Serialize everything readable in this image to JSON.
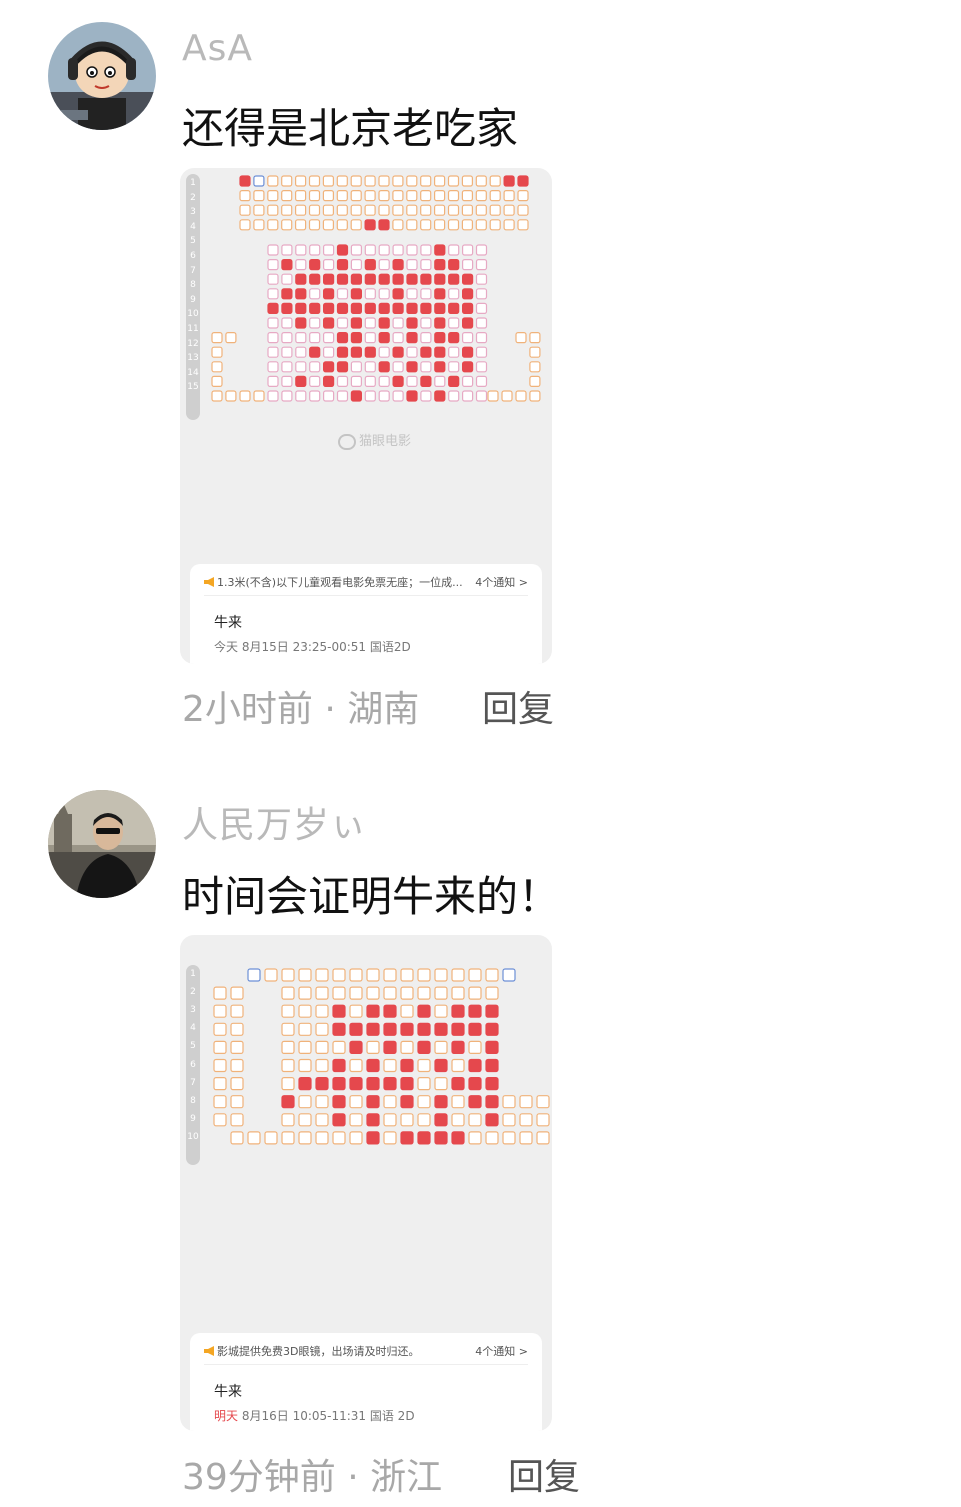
{
  "comments": [
    {
      "username": "AsA",
      "text": "还得是北京老吃家",
      "time_location": "2小时前 · 湖南",
      "reply_label": "回复",
      "avatar_icon": "cartoon-headphones-avatar",
      "screenshot": {
        "row_numbers": [
          "1",
          "2",
          "3",
          "4",
          "5",
          "6",
          "7",
          "8",
          "9",
          "10",
          "11",
          "12",
          "13",
          "14",
          "15"
        ],
        "watermark": "猫眼电影",
        "notice": "1.3米(不含)以下儿童观看电影免票无座；一位成...",
        "notice_count": "4个通知 >",
        "movie_title": "牛来",
        "showtime_day": "今天",
        "showtime": "8月15日 23:25-00:51 国语2D"
      }
    },
    {
      "username": "人民万岁ぃ",
      "text": "时间会证明牛来的！",
      "time_location": "39分钟前 · 浙江",
      "reply_label": "回复",
      "avatar_icon": "photo-avatar",
      "screenshot": {
        "row_numbers": [
          "1",
          "2",
          "3",
          "4",
          "5",
          "6",
          "7",
          "8",
          "9",
          "10"
        ],
        "notice": "影城提供免费3D眼镜，出场请及时归还。",
        "notice_count": "4个通知 >",
        "movie_title": "牛来",
        "showtime_day": "明天",
        "showtime": "8月16日  10:05-11:31  国语 2D"
      }
    }
  ],
  "colors": {
    "seat_standard": "#f0b27a",
    "seat_vip": "#e7a9c4",
    "seat_sold": "#e5484d",
    "seat_couple": "#6c8fd6",
    "meta_gray": "#a8a8a8"
  }
}
